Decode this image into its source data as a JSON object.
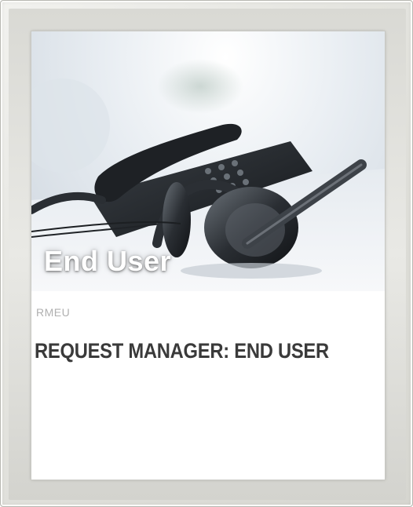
{
  "card": {
    "hero_title": "End User",
    "code": "RMEU",
    "title": "REQUEST MANAGER: END USER"
  },
  "icons": {
    "hero": "desk-phone-and-headset-photo"
  },
  "colors": {
    "frame": "#e4e4df",
    "title_text": "#3a3a3a",
    "code_text": "#b0b0b0",
    "hero_text": "#ffffff"
  }
}
